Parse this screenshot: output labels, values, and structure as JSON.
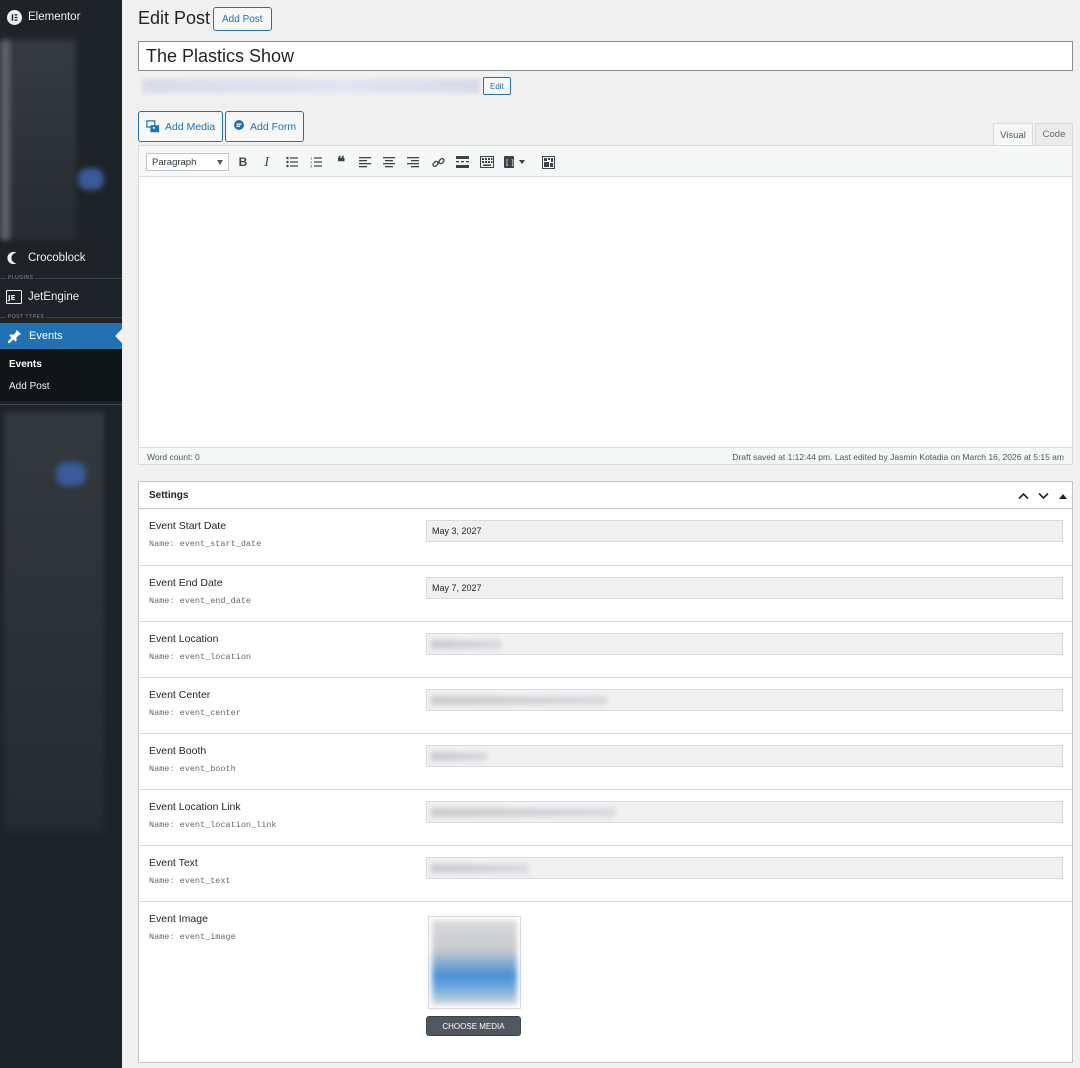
{
  "sidebar": {
    "elementor_label": "Elementor",
    "crocoblock_label": "Crocoblock",
    "plugins_section": "PLUGINS",
    "jetengine_label": "JetEngine",
    "post_types_section": "POST TYPES",
    "events_label": "Events",
    "submenu": [
      "Events",
      "Add Post"
    ]
  },
  "header": {
    "title": "Edit Post",
    "add_post_label": "Add Post"
  },
  "post": {
    "title_value": "The Plastics Show",
    "edit_slug_label": "Edit"
  },
  "media_buttons": {
    "add_media": "Add Media",
    "add_form": "Add Form"
  },
  "editor": {
    "tab_visual": "Visual",
    "tab_code": "Code",
    "format_value": "Paragraph",
    "word_count": "Word count: 0",
    "draft_status": "Draft saved at 1:12:44 pm. Last edited by Jasmin Kotadia on March 16, 2026 at 5:15 am"
  },
  "settings": {
    "title": "Settings",
    "fields": [
      {
        "label": "Event Start Date",
        "name": "Name: event_start_date",
        "value": "May 3, 2027"
      },
      {
        "label": "Event End Date",
        "name": "Name: event_end_date",
        "value": "May 7, 2027"
      },
      {
        "label": "Event Location",
        "name": "Name: event_location",
        "value": ""
      },
      {
        "label": "Event Center",
        "name": "Name: event_center",
        "value": ""
      },
      {
        "label": "Event Booth",
        "name": "Name: event_booth",
        "value": ""
      },
      {
        "label": "Event Location Link",
        "name": "Name: event_location_link",
        "value": ""
      },
      {
        "label": "Event Text",
        "name": "Name: event_text",
        "value": ""
      },
      {
        "label": "Event Image",
        "name": "Name: event_image",
        "value": ""
      }
    ],
    "choose_media_label": "CHOOSE MEDIA"
  },
  "colors": {
    "sidebar_bg": "#1d2327",
    "accent": "#2271b1",
    "page_bg": "#f0f0f1"
  }
}
